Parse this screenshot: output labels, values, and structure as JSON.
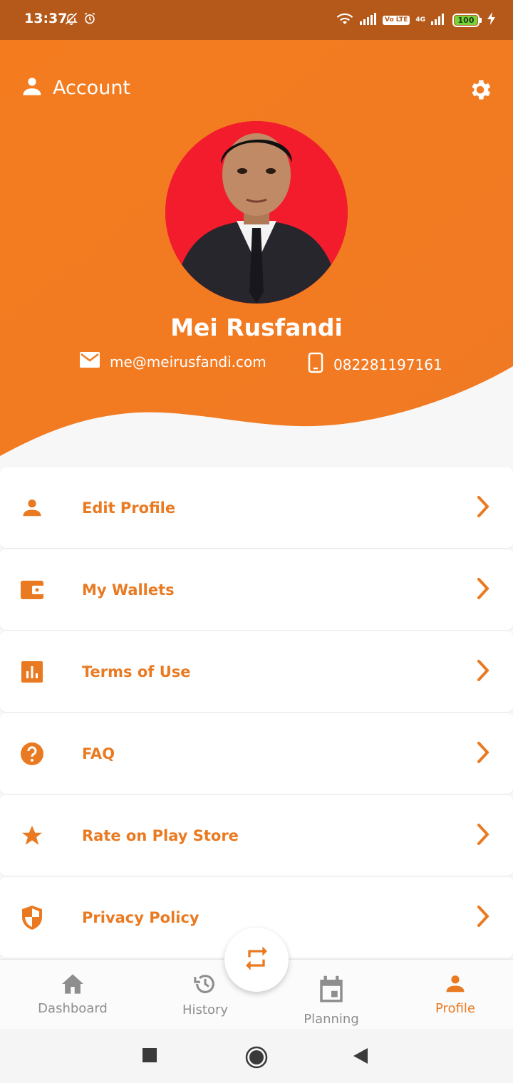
{
  "status_bar": {
    "time": "13:37",
    "network_label": "4G",
    "volte_label": "Vo LTE",
    "battery": "100"
  },
  "header": {
    "title": "Account",
    "colors": {
      "start": "#f47c1f",
      "end": "#f07a24"
    }
  },
  "profile": {
    "name": "Mei Rusfandi",
    "email": "me@meirusfandi.com",
    "phone": "082281197161"
  },
  "menu": {
    "items": [
      {
        "label": "Edit Profile",
        "icon": "person-icon"
      },
      {
        "label": "My Wallets",
        "icon": "wallet-icon"
      },
      {
        "label": "Terms of Use",
        "icon": "bar-chart-icon"
      },
      {
        "label": "FAQ",
        "icon": "help-circle-icon"
      },
      {
        "label": "Rate on Play Store",
        "icon": "star-icon"
      },
      {
        "label": "Privacy Policy",
        "icon": "shield-icon"
      }
    ]
  },
  "bottom_nav": {
    "items": [
      {
        "label": "Dashboard",
        "icon": "home-icon",
        "active": false
      },
      {
        "label": "History",
        "icon": "history-icon",
        "active": false
      },
      {
        "label": "Planning",
        "icon": "calendar-icon",
        "active": false
      },
      {
        "label": "Profile",
        "icon": "person-icon",
        "active": true
      }
    ],
    "fab_icon": "repeat-icon"
  },
  "theme": {
    "accent": "#ea7a21",
    "status_bar": "#b5591b",
    "inactive": "#8e8e8e"
  }
}
